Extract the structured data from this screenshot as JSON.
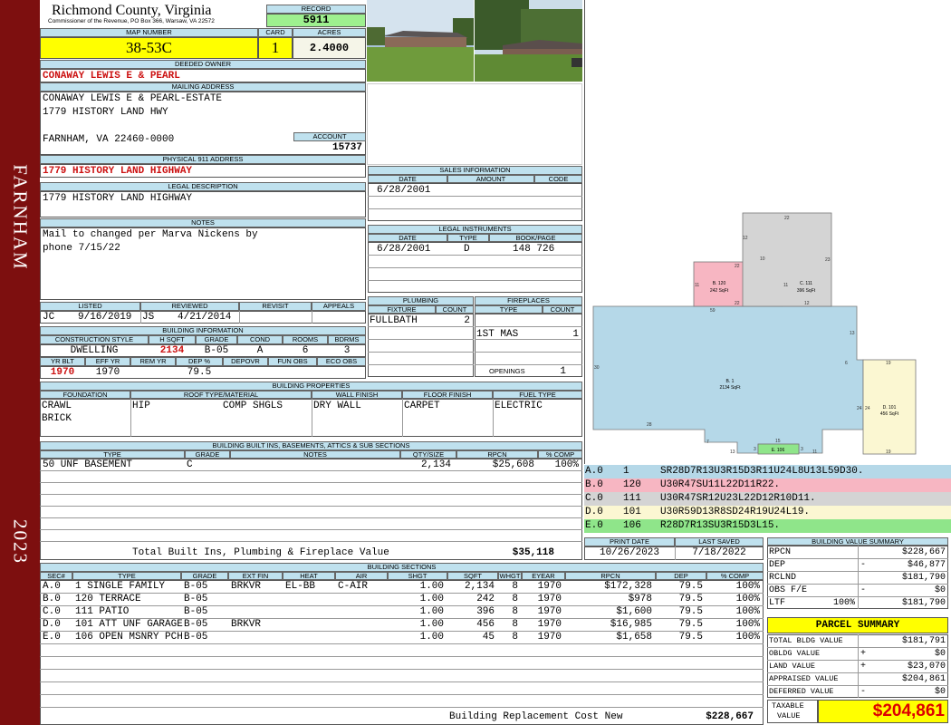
{
  "sidebar": {
    "town": "FARNHAM",
    "year": "2023"
  },
  "header": {
    "county": "Richmond County, Virginia",
    "commissioner": "Commissioner of the Revenue, PO Box 366, Warsaw, VA 22572",
    "record_label": "RECORD",
    "record": "5911",
    "map_label": "MAP NUMBER",
    "map": "38-53C",
    "card_label": "CARD",
    "card": "1",
    "acres_label": "ACRES",
    "acres": "2.4000"
  },
  "owner": {
    "label": "DEEDED OWNER",
    "name": "CONAWAY LEWIS E & PEARL"
  },
  "mailing": {
    "label": "MAILING ADDRESS",
    "line1": "CONAWAY LEWIS E & PEARL-ESTATE",
    "line2": "1779 HISTORY LAND HWY",
    "line3": "FARNHAM, VA 22460-0000",
    "account_label": "ACCOUNT",
    "account": "15737"
  },
  "physical": {
    "label": "PHYSICAL 911 ADDRESS",
    "address": "1779 HISTORY LAND HIGHWAY"
  },
  "legal": {
    "label": "LEGAL DESCRIPTION",
    "text": "1779 HISTORY LAND HIGHWAY"
  },
  "notes": {
    "label": "NOTES",
    "line1": "Mail to changed per Marva Nickens by",
    "line2": "phone 7/15/22"
  },
  "review": {
    "listed_label": "LISTED",
    "reviewed_label": "REVIEWED",
    "revisit_label": "REVISIT",
    "appeals_label": "APPEALS",
    "listed_by": "JC",
    "listed_date": "9/16/2019",
    "reviewed_by": "JS",
    "reviewed_date": "4/21/2014"
  },
  "building_info": {
    "label": "BUILDING INFORMATION",
    "h_style": "CONSTRUCTION STYLE",
    "h_sqft": "H SQFT",
    "h_grade": "GRADE",
    "h_cond": "COND",
    "h_rooms": "ROOMS",
    "h_bdrms": "BDRMS",
    "style": "DWELLING",
    "sqft": "2134",
    "grade": "B-05",
    "cond": "A",
    "rooms": "6",
    "bdrms": "3",
    "h_yrblt": "YR BLT",
    "h_effyr": "EFF YR",
    "h_remyr": "REM YR",
    "h_dep": "DEP %",
    "h_depovr": "DEPOVR",
    "h_funobs": "FUN OBS",
    "h_ecoobs": "ECO OBS",
    "yrblt": "1970",
    "effyr": "1970",
    "dep": "79.5"
  },
  "sales": {
    "label": "SALES INFORMATION",
    "h_date": "DATE",
    "h_amount": "AMOUNT",
    "h_code": "CODE",
    "date": "6/28/2001"
  },
  "legal_instr": {
    "label": "LEGAL INSTRUMENTS",
    "h_date": "DATE",
    "h_type": "TYPE",
    "h_book": "BOOK/PAGE",
    "date": "6/28/2001",
    "type": "D",
    "book": "148 726"
  },
  "plumbing": {
    "label": "PLUMBING",
    "h_fixture": "FIXTURE",
    "h_count": "COUNT",
    "fixture": "FULLBATH",
    "count": "2"
  },
  "fireplaces": {
    "label": "FIREPLACES",
    "h_type": "TYPE",
    "h_count": "COUNT",
    "type": "1ST MAS",
    "count": "1",
    "openings_label": "OPENINGS",
    "openings": "1"
  },
  "props": {
    "label": "BUILDING PROPERTIES",
    "h_found": "FOUNDATION",
    "h_roof": "ROOF TYPE/MATERIAL",
    "h_wall": "WALL FINISH",
    "h_floor": "FLOOR FINISH",
    "h_fuel": "FUEL TYPE",
    "found1": "CRAWL",
    "found2": "BRICK",
    "roof_type": "HIP",
    "roof_mat": "COMP SHGLS",
    "wall": "DRY WALL",
    "floor": "CARPET",
    "fuel": "ELECTRIC"
  },
  "builtins": {
    "label": "BUILDING BUILT INS, BASEMENTS, ATTICS & SUB SECTIONS",
    "h_type": "TYPE",
    "h_grade": "GRADE",
    "h_notes": "NOTES",
    "h_qty": "QTY/SIZE",
    "h_rpcn": "RPCN",
    "h_comp": "% COMP",
    "row_type": "50 UNF BASEMENT",
    "row_grade": "C",
    "row_qty": "2,134",
    "row_rpcn": "$25,608",
    "row_comp": "100%",
    "total_label": "Total Built Ins, Plumbing & Fireplace Value",
    "total": "$35,118"
  },
  "sketch_codes": [
    {
      "sec": "A.0",
      "code": "1",
      "vectors": "SR28D7R13U3R15D3R11U24L8U13L59D30.",
      "color": "#b5d8e8"
    },
    {
      "sec": "B.0",
      "code": "120",
      "vectors": "U30R47SU11L22D11R22.",
      "color": "#f7b6c2"
    },
    {
      "sec": "C.0",
      "code": "111",
      "vectors": "U30R47SR12U23L22D12R10D11.",
      "color": "#d4d4d4"
    },
    {
      "sec": "D.0",
      "code": "101",
      "vectors": "U30R59D13R8SD24R19U24L19.",
      "color": "#fbf7d2"
    },
    {
      "sec": "E.0",
      "code": "106",
      "vectors": "R28D7R13SU3R15D3L15.",
      "color": "#8fe58a"
    }
  ],
  "sketch": {
    "A_label": "B. 1",
    "A_area": "2134 SqFt",
    "B_label": "B. 120",
    "B_area": "242 SqFt",
    "C_label": "C. 111",
    "C_area": "396 SqFt",
    "D_label": "D. 101",
    "D_area": "456 SqFt",
    "E_label": "E. 106",
    "dims": [
      "22",
      "12",
      "23",
      "10",
      "22",
      "11",
      "11",
      "12",
      "22",
      "59",
      "13",
      "30",
      "6",
      "19",
      "24",
      "24",
      "28",
      "7",
      "15",
      "13",
      "3",
      "3",
      "11",
      "19"
    ]
  },
  "print": {
    "print_label": "PRINT DATE",
    "saved_label": "LAST SAVED",
    "print_date": "10/26/2023",
    "last_saved": "7/18/2022"
  },
  "sections": {
    "label": "BUILDING SECTIONS",
    "headers": [
      "SEC#",
      "TYPE",
      "GRADE",
      "EXT FIN",
      "HEAT",
      "AIR",
      "SHGT",
      "SQFT",
      "WHGT",
      "EYEAR",
      "RPCN",
      "DEP",
      "% COMP"
    ],
    "rows": [
      [
        "A.0",
        "1 SINGLE FAMILY",
        "B-05",
        "BRKVR",
        "EL-BB",
        "C-AIR",
        "1.00",
        "2,134",
        "8",
        "1970",
        "$172,328",
        "79.5",
        "100%"
      ],
      [
        "B.0",
        "120 TERRACE",
        "B-05",
        "",
        "",
        "",
        "1.00",
        "242",
        "8",
        "1970",
        "$978",
        "79.5",
        "100%"
      ],
      [
        "C.0",
        "111 PATIO",
        "B-05",
        "",
        "",
        "",
        "1.00",
        "396",
        "8",
        "1970",
        "$1,600",
        "79.5",
        "100%"
      ],
      [
        "D.0",
        "101 ATT UNF GARAGE",
        "B-05",
        "BRKVR",
        "",
        "",
        "1.00",
        "456",
        "8",
        "1970",
        "$16,985",
        "79.5",
        "100%"
      ],
      [
        "E.0",
        "106 OPEN MSNRY PCH",
        "B-05",
        "",
        "",
        "",
        "1.00",
        "45",
        "8",
        "1970",
        "$1,658",
        "79.5",
        "100%"
      ]
    ],
    "total_label": "Building Replacement Cost New",
    "total": "$228,667"
  },
  "value_summary": {
    "label": "BUILDING VALUE SUMMARY",
    "rpcn_label": "RPCN",
    "rpcn": "$228,667",
    "dep_label": "DEP",
    "dep_sign": "-",
    "dep": "$46,877",
    "rclnd_label": "RCLND",
    "rclnd": "$181,790",
    "obs_label": "OBS F/E",
    "obs_sign": "-",
    "obs": "$0",
    "ltr_label": "LTF",
    "ltr_pct": "100%",
    "ltr": "$181,790"
  },
  "parcel": {
    "label": "PARCEL SUMMARY",
    "bldg_label": "TOTAL BLDG VALUE",
    "bldg": "$181,791",
    "obldg_label": "OBLDG VALUE",
    "obldg_sign": "+",
    "obldg": "$0",
    "land_label": "LAND VALUE",
    "land_sign": "+",
    "land": "$23,070",
    "appraised_label": "APPRAISED VALUE",
    "appraised": "$204,861",
    "deferred_label": "DEFERRED VALUE",
    "deferred_sign": "-",
    "deferred": "$0",
    "taxable_label1": "TAXABLE",
    "taxable_label2": "VALUE",
    "taxable": "$204,861"
  }
}
